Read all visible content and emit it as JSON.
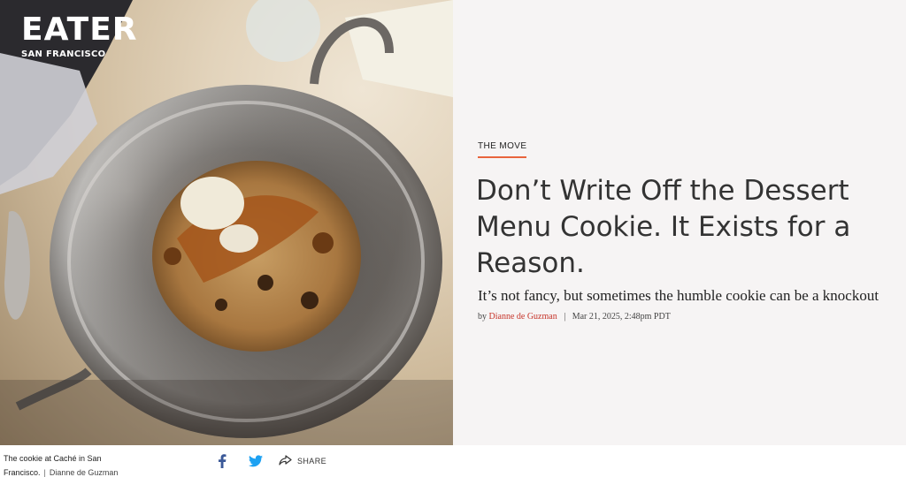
{
  "brand": {
    "name": "EATER",
    "city": "SAN FRANCISCO"
  },
  "hero": {
    "alt": "The cookie at Caché in San Francisco"
  },
  "article": {
    "kicker": "THE MOVE",
    "headline": "Don’t Write Off the Dessert Menu Cookie. It Exists for a Reason.",
    "dek": "It’s not fancy, but sometimes the humble cookie can be a knockout",
    "byline_prefix": "by",
    "author": "Dianne de Guzman",
    "byline_separator": "|",
    "timestamp": "Mar 21, 2025, 2:48pm PDT"
  },
  "caption": {
    "text": "The cookie at Caché in San Francisco.",
    "separator": "|",
    "credit": "Dianne de Guzman"
  },
  "share": {
    "facebook_icon": "facebook-icon",
    "twitter_icon": "twitter-icon",
    "share_icon": "share-icon",
    "label": "SHARE"
  },
  "colors": {
    "accent": "#e8643c",
    "author_link": "#c6352b",
    "panel_bg": "#f6f4f4",
    "headline_text": "#333333",
    "facebook": "#3b5998",
    "twitter": "#1da1f2"
  }
}
